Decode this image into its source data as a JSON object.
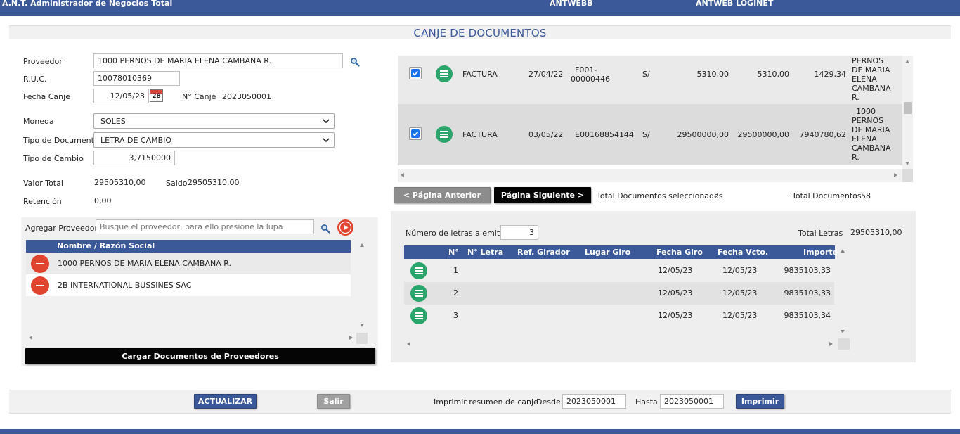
{
  "topbar": {
    "app_title": "A.N.T. Administrador de Negocios Total",
    "center_label": "ANTWEBB",
    "right_label": "ANTWEB LOGINET"
  },
  "page_title": "CANJE DE DOCUMENTOS",
  "form": {
    "proveedor_label": "Proveedor",
    "proveedor_value": "1000 PERNOS DE MARIA ELENA CAMBANA R.",
    "ruc_label": "R.U.C.",
    "ruc_value": "10078010369",
    "fecha_canje_label": "Fecha Canje",
    "fecha_canje_value": "12/05/23",
    "calendar_day": "28",
    "nro_canje_label": "N° Canje",
    "nro_canje_value": "2023050001",
    "moneda_label": "Moneda",
    "moneda_value": "SOLES",
    "tipo_doc_label": "Tipo de Documento",
    "tipo_doc_value": "LETRA DE CAMBIO",
    "tipo_cambio_label": "Tipo de Cambio",
    "tipo_cambio_value": "3,7150000",
    "valor_total_label": "Valor Total",
    "valor_total_value": "29505310,00",
    "saldo_label": "Saldo",
    "saldo_value": "29505310,00",
    "retencion_label": "Retención",
    "retencion_value": "0,00"
  },
  "providers": {
    "agregar_label": "Agregar Proveedor",
    "search_placeholder": "Busque el proveedor, para ello presione la lupa",
    "header": "Nombre / Razón Social",
    "rows": [
      {
        "name": "1000 PERNOS DE MARIA ELENA CAMBANA R."
      },
      {
        "name": "2B INTERNATIONAL BUSSINES SAC"
      }
    ],
    "load_button": "Cargar Documentos de Proveedores"
  },
  "documents": {
    "rows": [
      {
        "tipo": "FACTURA",
        "fecha": "27/04/22",
        "numero_line1": "F001-",
        "numero_line2": "00000446",
        "moneda": "S/",
        "importe": "5310,00",
        "saldo": "5310,00",
        "tc": "1429,34",
        "proveedor_lines": [
          "PERNOS",
          "DE MARIA",
          "ELENA",
          "CAMBANA",
          "R."
        ]
      },
      {
        "tipo": "FACTURA",
        "fecha": "03/05/22",
        "numero_line1": "E00168854144",
        "numero_line2": "",
        "moneda": "S/",
        "importe": "29500000,00",
        "saldo": "29500000,00",
        "tc": "7940780,62",
        "proveedor_lines": [
          "1000",
          "PERNOS",
          "DE MARIA",
          "ELENA",
          "CAMBANA",
          "R."
        ]
      }
    ],
    "prev_button": "< Página Anterior",
    "next_button": "Página Siguiente >",
    "total_selected_label": "Total Documentos seleccionados",
    "total_selected_value": "2",
    "total_docs_label": "Total Documentos",
    "total_docs_value": "58"
  },
  "letters": {
    "count_label": "Número de letras a emitir",
    "count_value": "3",
    "total_label": "Total Letras",
    "total_value": "29505310,00",
    "headers": [
      "N°",
      "N° Letra",
      "Ref. Girador",
      "Lugar Giro",
      "Fecha Giro",
      "Fecha Vcto.",
      "Importe"
    ],
    "rows": [
      {
        "n": "1",
        "fecha_giro": "12/05/23",
        "fecha_vcto": "12/05/23",
        "importe": "9835103,33"
      },
      {
        "n": "2",
        "fecha_giro": "12/05/23",
        "fecha_vcto": "12/05/23",
        "importe": "9835103,33"
      },
      {
        "n": "3",
        "fecha_giro": "12/05/23",
        "fecha_vcto": "12/05/23",
        "importe": "9835103,34"
      }
    ]
  },
  "footer": {
    "actualizar_button": "ACTUALIZAR",
    "salir_button": "Salir",
    "imprimir_label": "Imprimir resumen de canje",
    "desde_label": "Desde",
    "desde_value": "2023050001",
    "hasta_label": "Hasta",
    "hasta_value": "2023050001",
    "imprimir_button": "Imprimir"
  },
  "colors": {
    "brand": "#3b5998",
    "green_icon": "#2aa56b",
    "red_icon": "#e0442e"
  }
}
